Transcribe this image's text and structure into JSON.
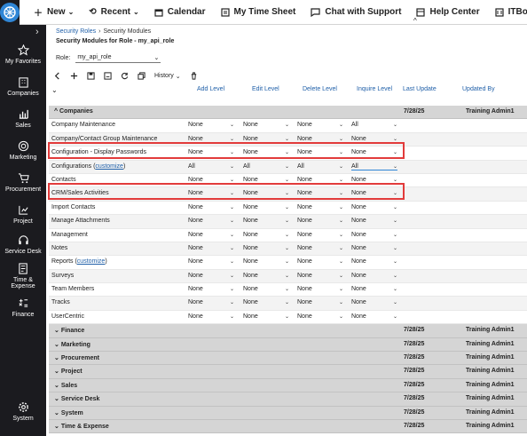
{
  "topnav": {
    "new": "New",
    "recent": "Recent",
    "calendar": "Calendar",
    "timesheet": "My Time Sheet",
    "chat": "Chat with Support",
    "help": "Help Center",
    "itboost": "ITBoost"
  },
  "sidebar": {
    "items": [
      {
        "label": "My Favorites",
        "icon": "star-icon"
      },
      {
        "label": "Companies",
        "icon": "building-icon"
      },
      {
        "label": "Sales",
        "icon": "bar-chart-icon"
      },
      {
        "label": "Marketing",
        "icon": "target-icon"
      },
      {
        "label": "Procurement",
        "icon": "cart-icon"
      },
      {
        "label": "Project",
        "icon": "project-icon"
      },
      {
        "label": "Service Desk",
        "icon": "headset-icon"
      },
      {
        "label": "Time &",
        "label2": "Expense",
        "icon": "time-expense-icon"
      },
      {
        "label": "Finance",
        "icon": "finance-icon"
      },
      {
        "label": "System",
        "icon": "gear-icon"
      }
    ]
  },
  "breadcrumb": {
    "parent": "Security Roles",
    "current": "Security Modules"
  },
  "page_title": "Security Modules for Role - my_api_role",
  "role": {
    "label": "Role:",
    "value": "my_api_role"
  },
  "toolbar": {
    "history": "History"
  },
  "columns": {
    "add": "Add Level",
    "edit": "Edit Level",
    "delete": "Delete Level",
    "inquire": "Inquire Level",
    "last_update": "Last Update",
    "updated_by": "Updated By"
  },
  "companies_group": {
    "label": "Companies",
    "date": "7/28/25",
    "by": "Training Admin1"
  },
  "rows": [
    {
      "name": "Company Maintenance",
      "customize": "",
      "add": "None",
      "edit": "None",
      "del": "None",
      "inq": "All"
    },
    {
      "name": "Company/Contact Group Maintenance",
      "customize": "",
      "add": "None",
      "edit": "None",
      "del": "None",
      "inq": "None"
    },
    {
      "name": "Configuration - Display Passwords",
      "customize": "",
      "add": "None",
      "edit": "None",
      "del": "None",
      "inq": "None"
    },
    {
      "name": "Configurations",
      "customize": "customize",
      "add": "All",
      "edit": "All",
      "del": "All",
      "inq": "All"
    },
    {
      "name": "Contacts",
      "customize": "",
      "add": "None",
      "edit": "None",
      "del": "None",
      "inq": "None"
    },
    {
      "name": "CRM/Sales Activities",
      "customize": "",
      "add": "None",
      "edit": "None",
      "del": "None",
      "inq": "None"
    },
    {
      "name": "Import Contacts",
      "customize": "",
      "add": "None",
      "edit": "None",
      "del": "None",
      "inq": "None"
    },
    {
      "name": "Manage Attachments",
      "customize": "",
      "add": "None",
      "edit": "None",
      "del": "None",
      "inq": "None"
    },
    {
      "name": "Management",
      "customize": "",
      "add": "None",
      "edit": "None",
      "del": "None",
      "inq": "None"
    },
    {
      "name": "Notes",
      "customize": "",
      "add": "None",
      "edit": "None",
      "del": "None",
      "inq": "None"
    },
    {
      "name": "Reports",
      "customize": "customize",
      "add": "None",
      "edit": "None",
      "del": "None",
      "inq": "None"
    },
    {
      "name": "Surveys",
      "customize": "",
      "add": "None",
      "edit": "None",
      "del": "None",
      "inq": "None"
    },
    {
      "name": "Team Members",
      "customize": "",
      "add": "None",
      "edit": "None",
      "del": "None",
      "inq": "None"
    },
    {
      "name": "Tracks",
      "customize": "",
      "add": "None",
      "edit": "None",
      "del": "None",
      "inq": "None"
    },
    {
      "name": "UserCentric",
      "customize": "",
      "add": "None",
      "edit": "None",
      "del": "None",
      "inq": "None"
    }
  ],
  "groups": [
    {
      "label": "Finance",
      "date": "7/28/25",
      "by": "Training Admin1"
    },
    {
      "label": "Marketing",
      "date": "7/28/25",
      "by": "Training Admin1"
    },
    {
      "label": "Procurement",
      "date": "7/28/25",
      "by": "Training Admin1"
    },
    {
      "label": "Project",
      "date": "7/28/25",
      "by": "Training Admin1"
    },
    {
      "label": "Sales",
      "date": "7/28/25",
      "by": "Training Admin1"
    },
    {
      "label": "Service Desk",
      "date": "7/28/25",
      "by": "Training Admin1"
    },
    {
      "label": "System",
      "date": "7/28/25",
      "by": "Training Admin1"
    },
    {
      "label": "Time & Expense",
      "date": "7/28/25",
      "by": "Training Admin1"
    }
  ]
}
